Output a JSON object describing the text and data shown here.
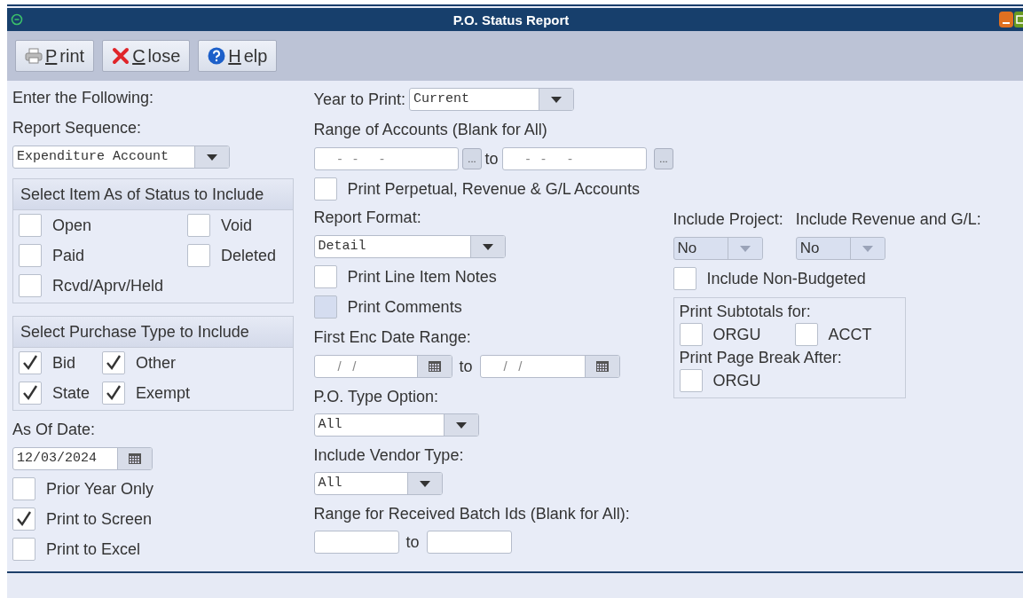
{
  "window": {
    "title": "P.O. Status Report"
  },
  "toolbar": [
    {
      "label": "Print",
      "kind": "print"
    },
    {
      "label": "Close",
      "kind": "close"
    },
    {
      "label": "Help",
      "kind": "help"
    }
  ],
  "left": {
    "intro": "Enter the Following:",
    "sequence_label": "Report Sequence:",
    "sequence_value": "Expenditure Account",
    "status_group": {
      "title": "Select Item As of Status to Include",
      "items": [
        {
          "label": "Open",
          "checked": false
        },
        {
          "label": "Void",
          "checked": false
        },
        {
          "label": "Paid",
          "checked": false
        },
        {
          "label": "Deleted",
          "checked": false
        },
        {
          "label": "Rcvd/Aprv/Held",
          "checked": false
        }
      ]
    },
    "type_group": {
      "title": "Select Purchase Type to Include",
      "items": [
        {
          "label": "Bid",
          "checked": true
        },
        {
          "label": "Other",
          "checked": true
        },
        {
          "label": "State",
          "checked": true
        },
        {
          "label": "Exempt",
          "checked": true
        }
      ]
    },
    "as_of_label": "As Of Date:",
    "as_of_value": "12/03/2024",
    "options": [
      {
        "label": "Prior Year Only",
        "checked": false
      },
      {
        "label": "Print to Screen",
        "checked": true
      },
      {
        "label": "Print to Excel",
        "checked": false
      }
    ]
  },
  "middle": {
    "year_label": "Year to Print:",
    "year_value": "Current",
    "accounts_label": "Range of Accounts (Blank for All)",
    "account_from": "-   -      -",
    "account_to": "-   -      -",
    "lookup": "...",
    "to": "to",
    "perpetual": {
      "label": "Print Perpetual, Revenue & G/L Accounts",
      "checked": false
    },
    "format_label": "Report Format:",
    "format_value": "Detail",
    "format_options": [
      {
        "label": "Print Line Item Notes",
        "checked": false,
        "disabled": false
      },
      {
        "label": "Print Comments",
        "checked": false,
        "disabled": true
      }
    ],
    "date_label": "First Enc Date Range:",
    "date_from": "/   /",
    "date_to": "/   /",
    "date_to_word": "to",
    "type_label": "P.O. Type Option:",
    "type_value": "All",
    "vendor_label": "Include Vendor Type:",
    "vendor_value": "All",
    "batch_label": "Range for Received Batch Ids (Blank for All):",
    "batch_to": "to"
  },
  "right": {
    "project_label": "Include Project:",
    "project_value": "No",
    "project_disabled": true,
    "revenue_label": "Include Revenue and G/L:",
    "revenue_value": "No",
    "revenue_disabled": true,
    "non_budgeted": {
      "label": "Include Non-Budgeted",
      "checked": false
    },
    "subtotals_label": "Print Subtotals for:",
    "subtotals": [
      {
        "label": "ORGU",
        "checked": false
      },
      {
        "label": "ACCT",
        "checked": false
      }
    ],
    "page_break_label": "Print Page Break After:",
    "page_break": [
      {
        "label": "ORGU",
        "checked": false
      }
    ]
  }
}
